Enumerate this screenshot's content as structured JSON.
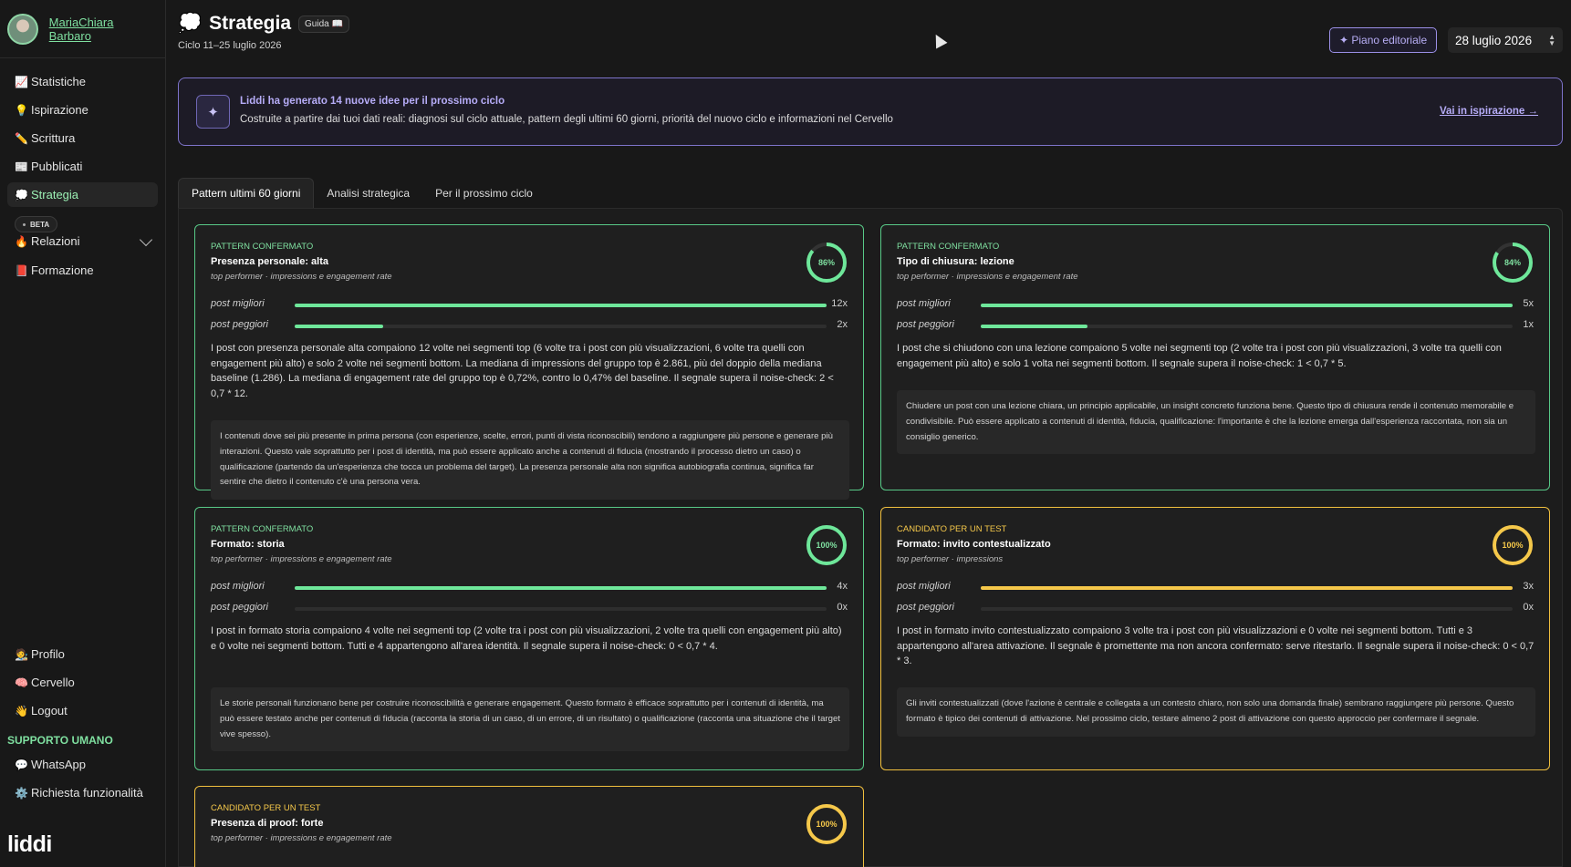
{
  "user": {
    "name": "MariaChiara Barbaro"
  },
  "nav": {
    "items": [
      {
        "icon": "📈",
        "label": "Statistiche"
      },
      {
        "icon": "💡",
        "label": "Ispirazione"
      },
      {
        "icon": "✏️",
        "label": "Scrittura"
      },
      {
        "icon": "📰",
        "label": "Pubblicati"
      },
      {
        "icon": "💭",
        "label": "Strategia"
      }
    ],
    "beta_badge": "BETA",
    "beta_item": {
      "icon": "🔥",
      "label": "Relazioni"
    },
    "formazione": {
      "icon": "📕",
      "label": "Formazione"
    },
    "bottom": [
      {
        "icon": "🧑‍🎨",
        "label": "Profilo"
      },
      {
        "icon": "🧠",
        "label": "Cervello"
      },
      {
        "icon": "👋",
        "label": "Logout"
      }
    ],
    "support_title": "SUPPORTO UMANO",
    "support_items": [
      {
        "icon": "💬",
        "label": "WhatsApp"
      },
      {
        "icon": "⚙️",
        "label": "Richiesta funzionalità"
      }
    ],
    "logo": "liddi"
  },
  "header": {
    "icon": "💭",
    "title": "Strategia",
    "guide": "Guida 📖",
    "subtitle": "Ciclo 11–25 luglio 2026",
    "plan_button": "✦ Piano editoriale",
    "date": "28 luglio 2026"
  },
  "banner": {
    "icon": "✦",
    "title": "Liddi ha generato 14 nuove idee per il prossimo ciclo",
    "desc": "Costruite a partire dai tuoi dati reali: diagnosi sul ciclo attuale, pattern degli ultimi 60 giorni, priorità del nuovo ciclo e informazioni nel Cervello",
    "link": "Vai in ispirazione →"
  },
  "tabs": [
    "Pattern ultimi 60 giorni",
    "Analisi strategica",
    "Per il prossimo ciclo"
  ],
  "bar_labels": {
    "best": "post migliori",
    "worst": "post peggiori"
  },
  "cards": [
    {
      "label": "PATTERN CONFERMATO",
      "title": "Presenza personale: alta",
      "meta": "top performer · impressions e engagement rate",
      "percent": "86%",
      "percent_value": 0.86,
      "best": 12,
      "best_text": "12x",
      "worst": 2,
      "worst_text": "2x",
      "body": "I post con presenza personale alta compaiono 12 volte nei segmenti top (6 volte tra i post con più visualizzazioni, 6 volte tra quelli con engagement più alto) e solo 2 volte nei segmenti bottom. La mediana di impressions del gruppo top è 2.861, più del doppio della mediana baseline (1.286). La mediana di engagement rate del gruppo top è 0,72%, contro lo 0,47% del baseline. Il segnale supera il noise-check: 2 < 0,7 * 12.",
      "note": "I contenuti dove sei più presente in prima persona (con esperienze, scelte, errori, punti di vista riconoscibili) tendono a raggiungere più persone e generare più interazioni. Questo vale soprattutto per i post di identità, ma può essere applicato anche a contenuti di fiducia (mostrando il processo dietro un caso) o qualificazione (partendo da un'esperienza che tocca un problema del target). La presenza personale alta non significa autobiografia continua, significa far sentire che dietro il contenuto c'è una persona vera."
    },
    {
      "label": "PATTERN CONFERMATO",
      "title": "Tipo di chiusura: lezione",
      "meta": "top performer · impressions e engagement rate",
      "percent": "84%",
      "percent_value": 0.84,
      "best": 5,
      "best_text": "5x",
      "worst": 1,
      "worst_text": "1x",
      "body": "I post che si chiudono con una lezione compaiono 5 volte nei segmenti top (2 volte tra i post con più visualizzazioni, 3 volte tra quelli con engagement più alto) e solo 1 volta nei segmenti bottom. Il segnale supera il noise-check: 1 < 0,7 * 5.",
      "note": "Chiudere un post con una lezione chiara, un principio applicabile, un insight concreto funziona bene. Questo tipo di chiusura rende il contenuto memorabile e condivisibile. Può essere applicato a contenuti di identità, fiducia, qualificazione: l'importante è che la lezione emerga dall'esperienza raccontata, non sia un consiglio generico."
    },
    {
      "label": "PATTERN CONFERMATO",
      "title": "Formato: storia",
      "meta": "top performer · impressions e engagement rate",
      "percent": "100%",
      "percent_value": 1.0,
      "best": 4,
      "best_text": "4x",
      "worst": 0,
      "worst_text": "0x",
      "body": "I post in formato storia compaiono 4 volte nei segmenti top (2 volte tra i post con più visualizzazioni, 2 volte tra quelli con engagement più alto) e 0 volte nei segmenti bottom. Tutti e 4 appartengono all'area identità. Il segnale supera il noise-check: 0 < 0,7 * 4.",
      "note": "Le storie personali funzionano bene per costruire riconoscibilità e generare engagement. Questo formato è efficace soprattutto per i contenuti di identità, ma può essere testato anche per contenuti di fiducia (racconta la storia di un caso, di un errore, di un risultato) o qualificazione (racconta una situazione che il target vive spesso)."
    },
    {
      "label": "CANDIDATO PER UN TEST",
      "title": "Formato: invito contestualizzato",
      "meta": "top performer · impressions",
      "percent": "100%",
      "percent_value": 1.0,
      "best": 3,
      "best_text": "3x",
      "worst": 0,
      "worst_text": "0x",
      "body": "I post in formato invito contestualizzato compaiono 3 volte tra i post con più visualizzazioni e 0 volte nei segmenti bottom. Tutti e 3 appartengono all'area attivazione. Il segnale è promettente ma non ancora confermato: serve ritestarlo. Il segnale supera il noise-check: 0 < 0,7 * 3.",
      "note": "Gli inviti contestualizzati (dove l'azione è centrale e collegata a un contesto chiaro, non solo una domanda finale) sembrano raggiungere più persone. Questo formato è tipico dei contenuti di attivazione. Nel prossimo ciclo, testare almeno 2 post di attivazione con questo approccio per confermare il segnale."
    },
    {
      "label": "CANDIDATO PER UN TEST",
      "title": "Presenza di proof: forte",
      "meta": "top performer · impressions e engagement rate",
      "percent": "100%",
      "percent_value": 1.0
    }
  ]
}
